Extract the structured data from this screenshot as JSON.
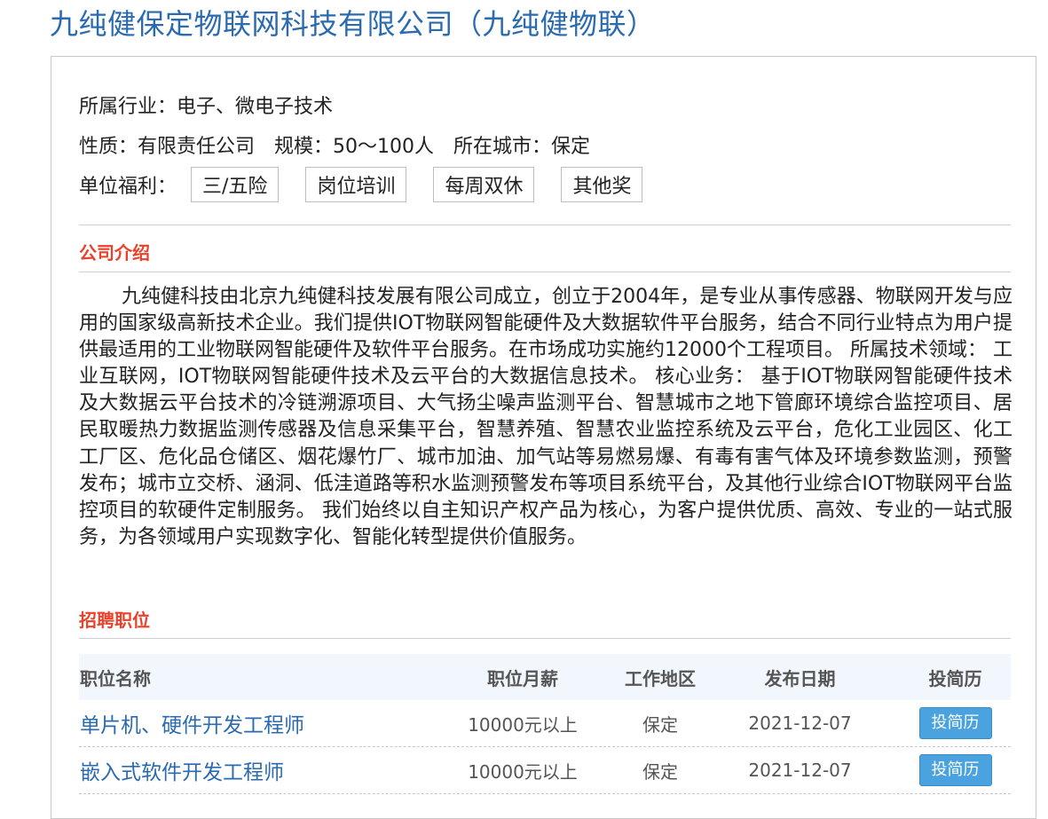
{
  "company": {
    "title": "九纯健保定物联网科技有限公司（九纯健物联）"
  },
  "info": {
    "industry": "所属行业：电子、微电子技术",
    "nature": "性质：有限责任公司",
    "scale": "规模：50～100人",
    "city": "所在城市：保定",
    "welfare_label": "单位福利：",
    "welfare": [
      "三/五险",
      "岗位培训",
      "每周双休",
      "其他奖"
    ]
  },
  "intro": {
    "heading": "公司介绍",
    "text": "九纯健科技由北京九纯健科技发展有限公司成立，创立于2004年，是专业从事传感器、物联网开发与应用的国家级高新技术企业。我们提供IOT物联网智能硬件及大数据软件平台服务，结合不同行业特点为用户提供最适用的工业物联网智能硬件及软件平台服务。在市场成功实施约12000个工程项目。 所属技术领域： 工业互联网，IOT物联网智能硬件技术及云平台的大数据信息技术。 核心业务： 基于IOT物联网智能硬件技术及大数据云平台技术的冷链溯源项目、大气扬尘噪声监测平台、智慧城市之地下管廊环境综合监控项目、居民取暖热力数据监测传感器及信息采集平台，智慧养殖、智慧农业监控系统及云平台，危化工业园区、化工工厂区、危化品仓储区、烟花爆竹厂、城市加油、加气站等易燃易爆、有毒有害气体及环境参数监测，预警发布；城市立交桥、涵洞、低洼道路等积水监测预警发布等项目系统平台，及其他行业综合IOT物联网平台监控项目的软硬件定制服务。 我们始终以自主知识产权产品为核心，为客户提供优质、高效、专业的一站式服务，为各领域用户实现数字化、智能化转型提供价值服务。"
  },
  "jobs": {
    "heading": "招聘职位",
    "columns": {
      "name": "职位名称",
      "salary": "职位月薪",
      "area": "工作地区",
      "date": "发布日期",
      "apply": "投简历"
    },
    "rows": [
      {
        "name": "单片机、硬件开发工程师",
        "salary": "10000元以上",
        "area": "保定",
        "date": "2021-12-07",
        "apply": "投简历"
      },
      {
        "name": "嵌入式软件开发工程师",
        "salary": "10000元以上",
        "area": "保定",
        "date": "2021-12-07",
        "apply": "投简历"
      }
    ]
  }
}
